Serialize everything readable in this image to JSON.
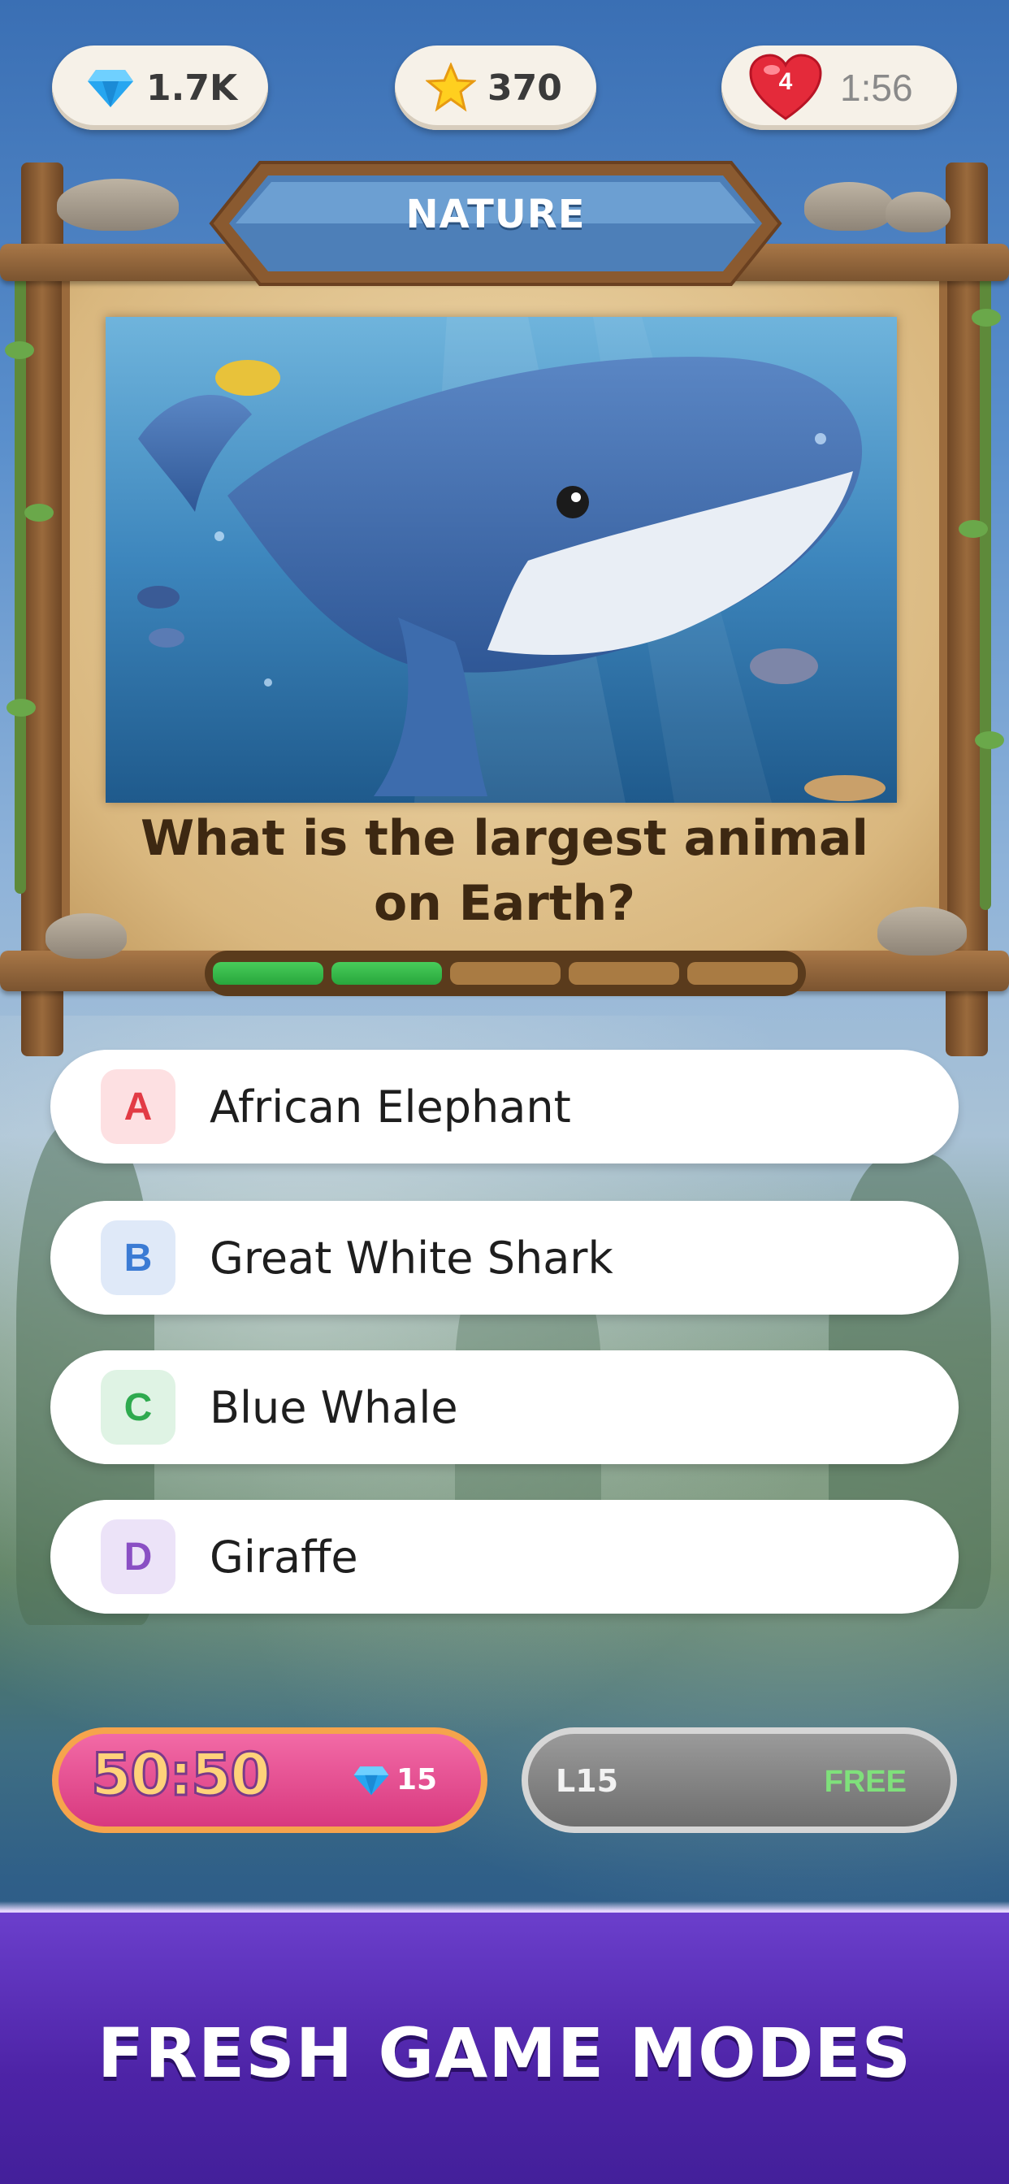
{
  "hud": {
    "gems": "1.7K",
    "stars": "370",
    "lives": "4",
    "life_timer": "1:56"
  },
  "category": "NATURE",
  "question": {
    "line1": "What is the largest animal",
    "line2": "on Earth?",
    "progress_segments": [
      true,
      true,
      false,
      false,
      false
    ]
  },
  "answers": [
    {
      "letter": "A",
      "text": "African Elephant",
      "badge_bg": "#fde0e2",
      "badge_color": "#e23b45"
    },
    {
      "letter": "B",
      "text": "Great White Shark",
      "badge_bg": "#dfe9f8",
      "badge_color": "#3b7bd4"
    },
    {
      "letter": "C",
      "text": "Blue Whale",
      "badge_bg": "#dff3e4",
      "badge_color": "#2faa4f"
    },
    {
      "letter": "D",
      "text": "Giraffe",
      "badge_bg": "#ece3f8",
      "badge_color": "#8a4fc4"
    }
  ],
  "powerups": {
    "fifty_label": "50:50",
    "fifty_cost": "15",
    "skip_level": "L15",
    "skip_price": "FREE"
  },
  "footer": {
    "title": "FRESH GAME MODES"
  },
  "colors": {
    "accent_pink": "#d8397f",
    "progress_green": "#28a63c",
    "footer_purple": "#4d23a6"
  }
}
